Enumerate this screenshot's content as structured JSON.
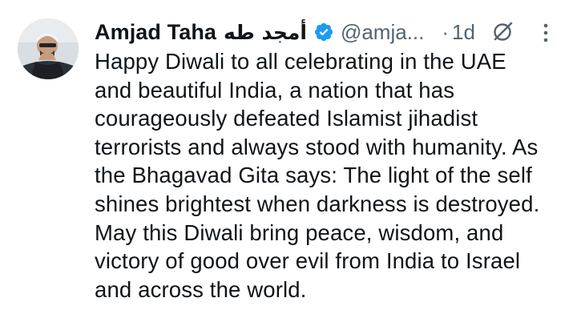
{
  "tweet": {
    "display_name": "Amjad Taha",
    "display_name_arabic": "أمجد طه",
    "verified_icon": "verified-badge-icon",
    "handle": "@amja...",
    "separator": "·",
    "time": "1d",
    "grok_icon": "grok-icon",
    "more_icon": "more-options-icon",
    "avatar_icon": "avatar",
    "lines": [
      "Happy Diwali to all celebrating in the UAE",
      "and beautiful India, a nation that has",
      "courageously defeated Islamist jihadist",
      "terrorists and always stood with humanity. As",
      "the Bhagavad Gita says: The light of the self",
      "shines brightest when darkness is destroyed.",
      "May this Diwali bring peace, wisdom, and",
      "victory of good over evil from India to Israel",
      "and across the world."
    ]
  },
  "colors": {
    "text": "#0f1419",
    "secondary": "#536471",
    "verified": "#1d9bf0",
    "background": "#ffffff"
  }
}
